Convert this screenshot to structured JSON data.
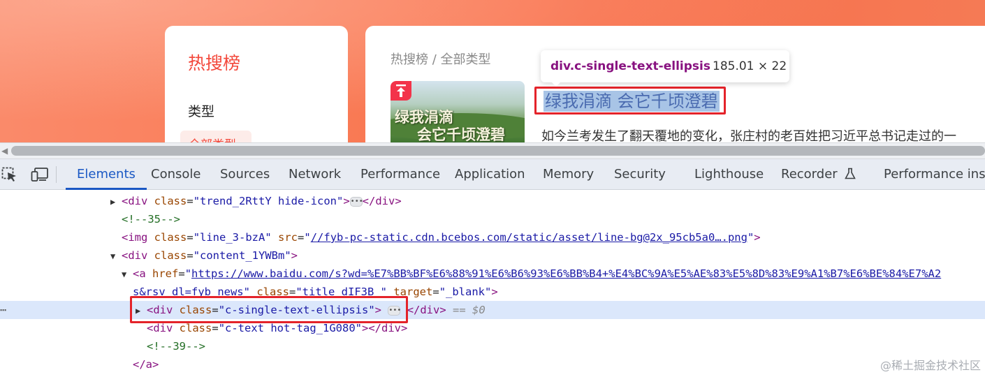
{
  "page": {
    "sidebar": {
      "title": "热搜榜",
      "type_label": "类型",
      "active_type": "全部类型"
    },
    "breadcrumb": "热搜榜 / 全部类型",
    "thumbnail": {
      "line1": "绿我涓滴",
      "line2": "会它千顷澄碧",
      "badge": "顶"
    },
    "headline": "绿我涓滴 会它千顷澄碧",
    "summary": "如今兰考发生了翻天覆地的变化，张庄村的老百姓把习近平总书记走过的一",
    "tooltip": {
      "tag": "div.c-single-text-ellipsis",
      "dims": "185.01 × 22"
    }
  },
  "devtools": {
    "tabs": [
      "Elements",
      "Console",
      "Sources",
      "Network",
      "Performance",
      "Application",
      "Memory",
      "Security",
      "Lighthouse",
      "Recorder",
      "Performance insigh"
    ],
    "active_tab": "Elements",
    "dom": {
      "l1": {
        "open": "<div",
        "attr": "class",
        "eq": "=",
        "val": "\"trend_2RttY hide-icon\"",
        "close": ">",
        "end": "</div>"
      },
      "l2": {
        "comment": "<!--35-->"
      },
      "l3": {
        "open": "<img",
        "a1": "class",
        "v1": "\"line_3-bzA\"",
        "a2": "src",
        "v2": "//fyb-pc-static.cdn.bcebos.com/static/asset/line-bg@2x_95cb5a0….png",
        "q": "\"",
        "close": ">"
      },
      "l4": {
        "open": "<div",
        "attr": "class",
        "val": "\"content_1YWBm\"",
        "close": ">"
      },
      "l5": {
        "open": "<a",
        "attr": "href",
        "val": "https://www.baidu.com/s?wd=%E7%BB%BF%E6%88%91%E6%B6%93%E6%BB%B4+%E4%BC%9A%E5%AE%83%E5%8D%83%E9%A1%B7%E6%BE%84%E7%A2"
      },
      "l6": {
        "val": "s&rsv_dl=fyb_news\"",
        "attr": "class",
        "val2": "\"title_dIF3B \"",
        "attr2": "target",
        "val3": "\"_blank\"",
        "close": ">"
      },
      "l7": {
        "open": "<div",
        "attr": "class",
        "val": "\"c-single-text-ellipsis\"",
        "close": ">",
        "end": "</div>",
        "marker": "== $0"
      },
      "l8": {
        "open": "<div",
        "attr": "class",
        "val": "\"c-text  hot-tag_1G080\"",
        "close": ">",
        "end": "</div>"
      },
      "l9": {
        "comment": "<!--39-->"
      },
      "l10": {
        "end": "</a>"
      }
    }
  },
  "watermark": "@稀土掘金技术社区"
}
